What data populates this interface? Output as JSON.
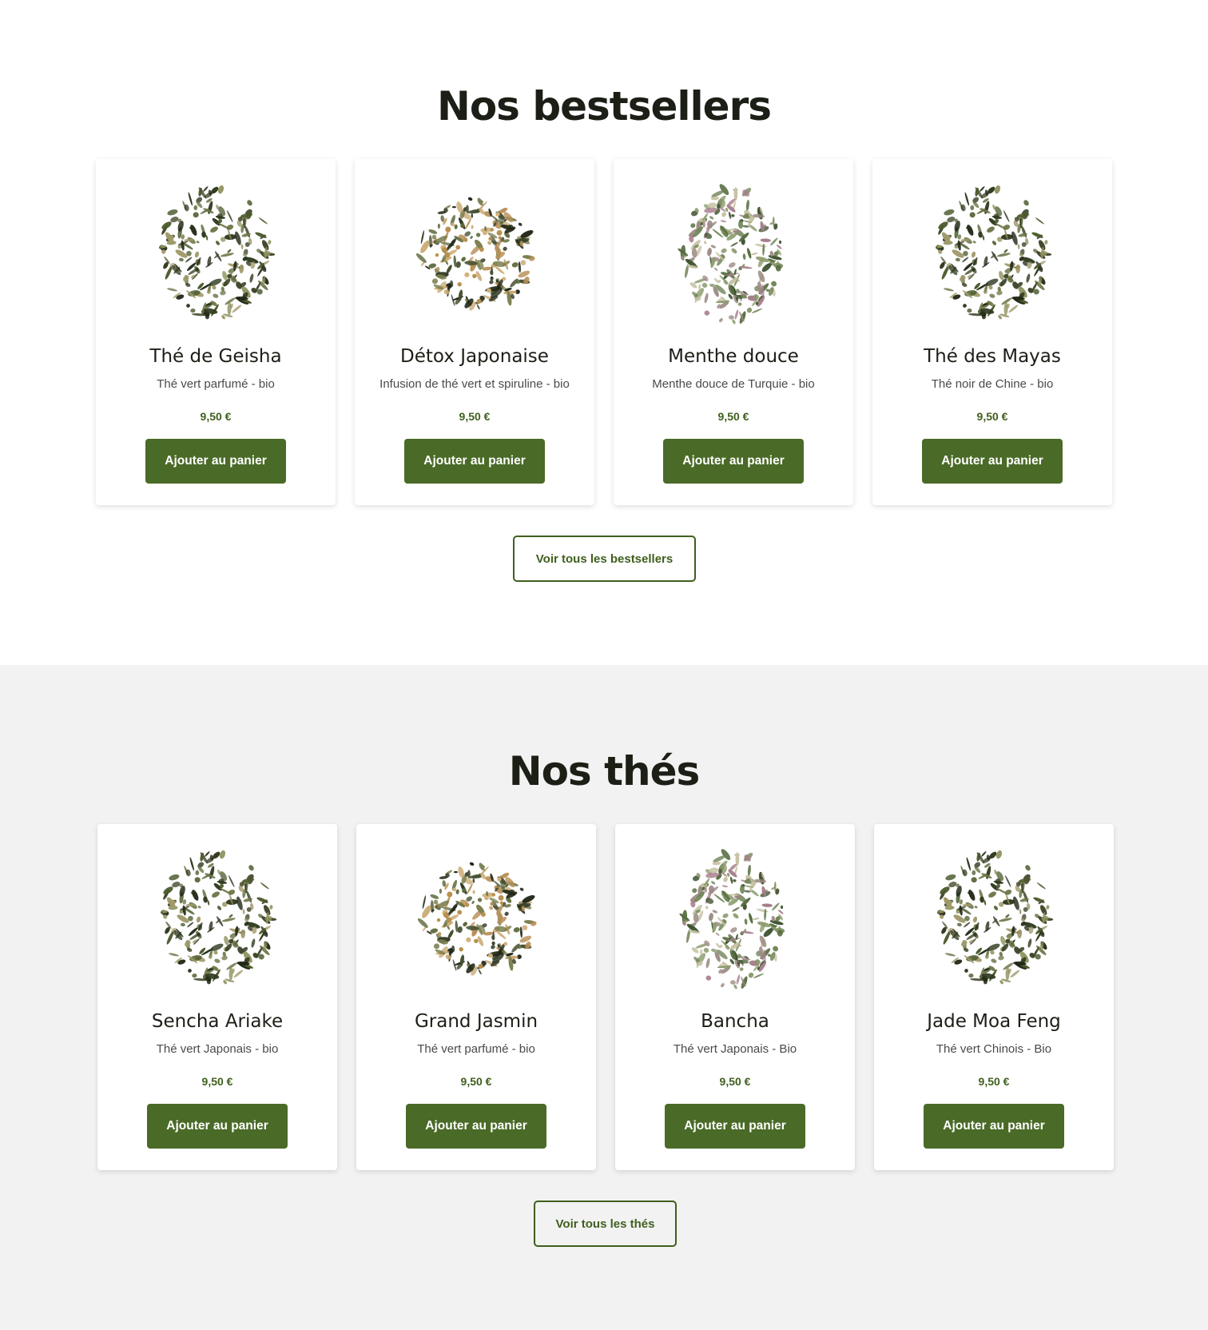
{
  "bestsellers": {
    "title": "Nos bestsellers",
    "see_all_label": "Voir tous les bestsellers",
    "products": [
      {
        "name": "Thé de Geisha",
        "description": "Thé vert parfumé - bio",
        "price": "9,50 €",
        "button_label": "Ajouter au panier",
        "image_icon": "loose-green-tea-leaves"
      },
      {
        "name": "Détox Japonaise",
        "description": "Infusion de thé vert et spiruline - bio",
        "price": "9,50 €",
        "button_label": "Ajouter au panier",
        "image_icon": "tea-blend-with-seeds"
      },
      {
        "name": "Menthe douce",
        "description": "Menthe douce de Turquie - bio",
        "price": "9,50 €",
        "button_label": "Ajouter au panier",
        "image_icon": "dried-mint-leaves"
      },
      {
        "name": "Thé des Mayas",
        "description": "Thé noir de Chine - bio",
        "price": "9,50 €",
        "button_label": "Ajouter au panier",
        "image_icon": "loose-green-tea-leaves"
      }
    ]
  },
  "teas": {
    "title": "Nos thés",
    "see_all_label": "Voir tous les thés",
    "products": [
      {
        "name": "Sencha Ariake",
        "description": "Thé vert Japonais - bio",
        "price": "9,50 €",
        "button_label": "Ajouter au panier",
        "image_icon": "loose-green-tea-leaves"
      },
      {
        "name": "Grand Jasmin",
        "description": "Thé vert parfumé - bio",
        "price": "9,50 €",
        "button_label": "Ajouter au panier",
        "image_icon": "tea-blend-with-seeds"
      },
      {
        "name": "Bancha",
        "description": "Thé vert Japonais - Bio",
        "price": "9,50 €",
        "button_label": "Ajouter au panier",
        "image_icon": "dried-mint-leaves"
      },
      {
        "name": "Jade Moa Feng",
        "description": "Thé vert Chinois - Bio",
        "price": "9,50 €",
        "button_label": "Ajouter au panier",
        "image_icon": "loose-green-tea-leaves"
      }
    ]
  },
  "colors": {
    "accent_green": "#4a6a27",
    "price_green": "#3f5f1d",
    "section_alt_background": "#f2f2f2",
    "text_dark": "#1c1f16"
  }
}
